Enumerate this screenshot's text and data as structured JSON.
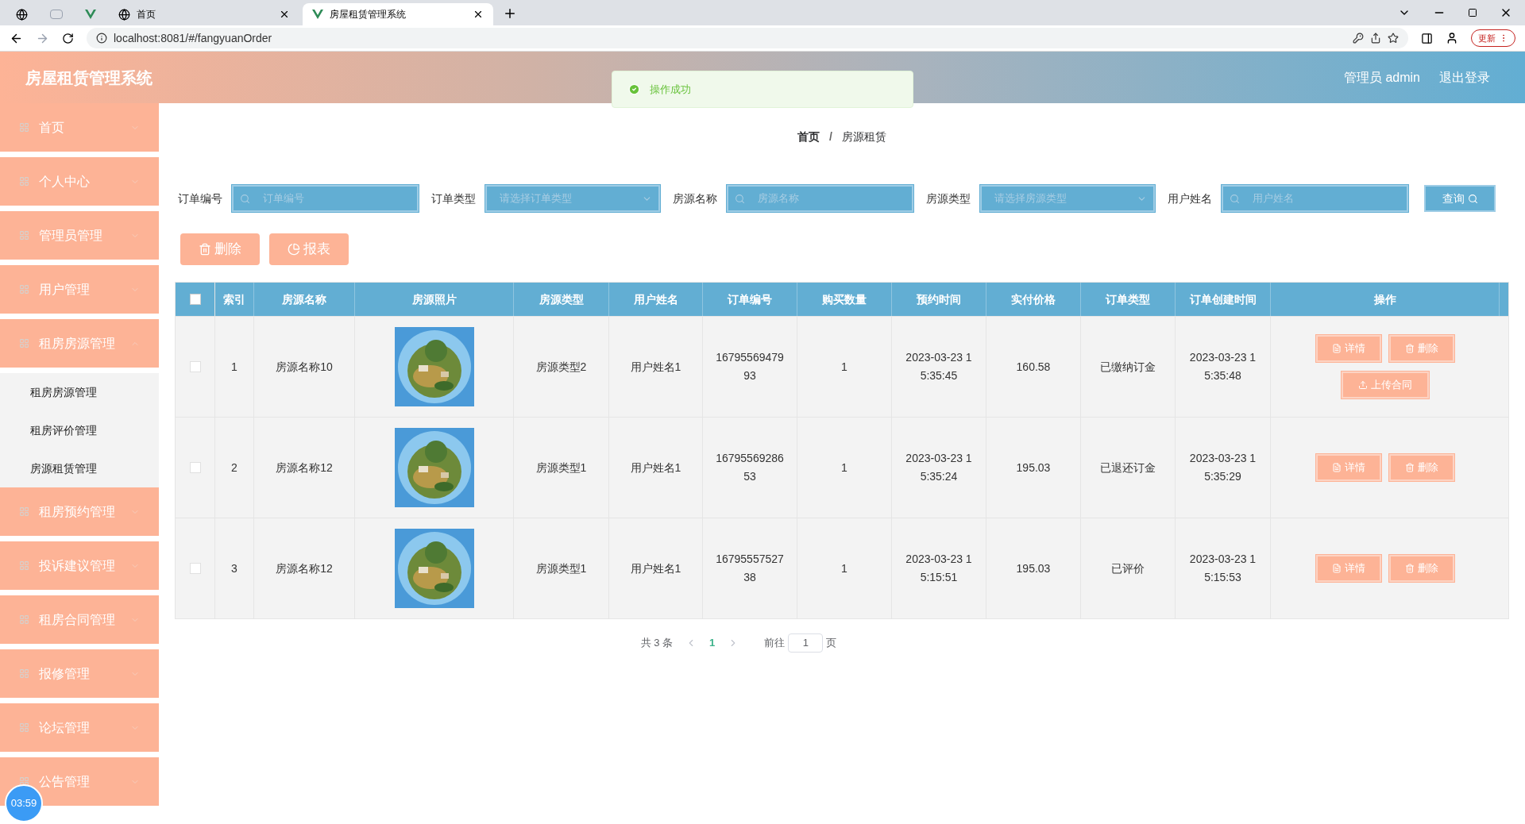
{
  "browser": {
    "tabs": [
      {
        "kind": "icon",
        "selected": false
      },
      {
        "kind": "icon",
        "selected": false
      },
      {
        "kind": "icon",
        "selected": false
      },
      {
        "kind": "page",
        "title": "首页",
        "selected": false
      },
      {
        "kind": "page",
        "title": "房屋租赁管理系统",
        "selected": true
      }
    ],
    "url": "localhost:8081/#/fangyuanOrder",
    "update_button": "更新"
  },
  "header": {
    "title": "房屋租赁管理系统",
    "user": "管理员 admin",
    "logout": "退出登录"
  },
  "toast": {
    "text": "操作成功"
  },
  "sidebar": {
    "items": [
      {
        "label": "首页",
        "expanded": false
      },
      {
        "label": "个人中心",
        "expanded": false
      },
      {
        "label": "管理员管理",
        "expanded": false
      },
      {
        "label": "用户管理",
        "expanded": false
      },
      {
        "label": "租房房源管理",
        "expanded": true,
        "children": [
          {
            "label": "租房房源管理"
          },
          {
            "label": "租房评价管理"
          },
          {
            "label": "房源租赁管理"
          }
        ]
      },
      {
        "label": "租房预约管理",
        "expanded": false
      },
      {
        "label": "投诉建议管理",
        "expanded": false
      },
      {
        "label": "租房合同管理",
        "expanded": false
      },
      {
        "label": "报修管理",
        "expanded": false
      },
      {
        "label": "论坛管理",
        "expanded": false
      },
      {
        "label": "公告管理",
        "expanded": false
      }
    ]
  },
  "breadcrumb": [
    "首页",
    "房源租赁"
  ],
  "breadcrumb_separator": "/",
  "filters": [
    {
      "label": "订单编号",
      "kind": "input",
      "placeholder": "订单编号"
    },
    {
      "label": "订单类型",
      "kind": "select",
      "placeholder": "请选择订单类型"
    },
    {
      "label": "房源名称",
      "kind": "input",
      "placeholder": "房源名称"
    },
    {
      "label": "房源类型",
      "kind": "select",
      "placeholder": "请选择房源类型"
    },
    {
      "label": "用户姓名",
      "kind": "input",
      "placeholder": "用户姓名"
    }
  ],
  "search_button": "查询",
  "toolbar": [
    {
      "label": "删除",
      "kind": "delete"
    },
    {
      "label": "报表",
      "kind": "report"
    }
  ],
  "table": {
    "columns": [
      "索引",
      "房源名称",
      "房源照片",
      "房源类型",
      "用户姓名",
      "订单编号",
      "购买数量",
      "预约时间",
      "实付价格",
      "订单类型",
      "订单创建时间",
      "操作"
    ],
    "header_checked": false,
    "rows": [
      {
        "checked": false,
        "index": "1",
        "name": "房源名称10",
        "photo": {
          "kind": "picture"
        },
        "type": "房源类型2",
        "user": "用户姓名1",
        "order_no": [
          "16795569479",
          "93"
        ],
        "qty": "1",
        "booking_time": [
          "2023-03-23 1",
          "5:35:45"
        ],
        "price": "160.58",
        "order_type": "已缴纳订金",
        "created": [
          "2023-03-23 1",
          "5:35:48"
        ],
        "actions": [
          {
            "label": "详情",
            "kind": "detail"
          },
          {
            "label": "删除",
            "kind": "delete"
          },
          {
            "label": "上传合同",
            "kind": "upload"
          }
        ]
      },
      {
        "checked": false,
        "index": "2",
        "name": "房源名称12",
        "photo": {
          "kind": "picture"
        },
        "type": "房源类型1",
        "user": "用户姓名1",
        "order_no": [
          "16795569286",
          "53"
        ],
        "qty": "1",
        "booking_time": [
          "2023-03-23 1",
          "5:35:24"
        ],
        "price": "195.03",
        "order_type": "已退还订金",
        "created": [
          "2023-03-23 1",
          "5:35:29"
        ],
        "actions": [
          {
            "label": "详情",
            "kind": "detail"
          },
          {
            "label": "删除",
            "kind": "delete"
          }
        ]
      },
      {
        "checked": false,
        "index": "3",
        "name": "房源名称12",
        "photo": {
          "kind": "picture"
        },
        "type": "房源类型1",
        "user": "用户姓名1",
        "order_no": [
          "16795557527",
          "38"
        ],
        "qty": "1",
        "booking_time": [
          "2023-03-23 1",
          "5:15:51"
        ],
        "price": "195.03",
        "order_type": "已评价",
        "created": [
          "2023-03-23 1",
          "5:15:53"
        ],
        "actions": [
          {
            "label": "详情",
            "kind": "detail"
          },
          {
            "label": "删除",
            "kind": "delete"
          }
        ]
      }
    ]
  },
  "pagination": {
    "total": "共 3 条",
    "pages": [
      {
        "label": "1",
        "selected": true
      }
    ],
    "goto": "前往",
    "page_value": "1",
    "page_suffix": "页"
  },
  "timer": "03:59"
}
